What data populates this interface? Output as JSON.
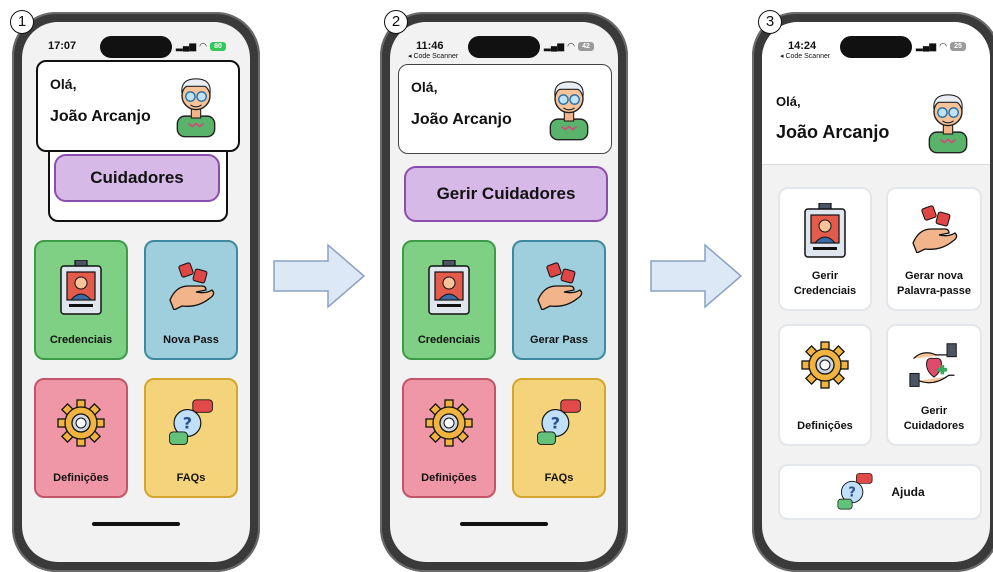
{
  "steps": [
    "1",
    "2",
    "3"
  ],
  "phone1": {
    "time": "17:07",
    "battery": "80",
    "greeting": "Olá,",
    "name": "João Arcanjo",
    "caregivers": "Cuidadores",
    "tiles": [
      "Credenciais",
      "Nova Pass",
      "Definições",
      "FAQs"
    ]
  },
  "phone2": {
    "time": "11:46",
    "back": "◂ Code Scanner",
    "battery": "42",
    "greeting": "Olá,",
    "name": "João Arcanjo",
    "caregivers": "Gerir Cuidadores",
    "tiles": [
      "Credenciais",
      "Gerar Pass",
      "Definições",
      "FAQs"
    ]
  },
  "phone3": {
    "time": "14:24",
    "back": "◂ Code Scanner",
    "battery": "25",
    "greeting": "Olá,",
    "name": "João Arcanjo",
    "tiles": [
      "Gerir Credenciais",
      "Gerar nova Palavra-passe",
      "Definições",
      "Gerir Cuidadores"
    ],
    "help": "Ajuda"
  },
  "colors": {
    "green": "#7fcf84",
    "blue": "#9fcfdc",
    "pink": "#ef97a6",
    "yellow": "#f5d37a",
    "purple": "#d7b9e7",
    "arrow": "#dde8f6"
  }
}
